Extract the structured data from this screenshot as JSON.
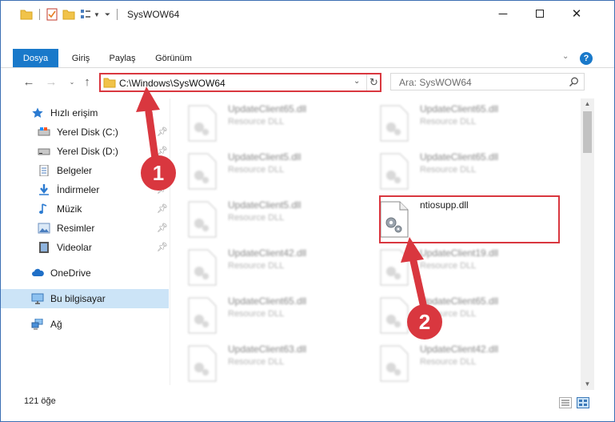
{
  "window": {
    "title": "SysWOW64",
    "minimize_icon": "minimize-icon",
    "maximize_icon": "maximize-icon",
    "close_icon": "close-icon"
  },
  "ribbon": {
    "tabs": [
      {
        "label": "Dosya"
      },
      {
        "label": "Giriş"
      },
      {
        "label": "Paylaş"
      },
      {
        "label": "Görünüm"
      }
    ],
    "help_glyph": "?"
  },
  "address": {
    "path": "C:\\Windows\\SysWOW64"
  },
  "search": {
    "placeholder": "Ara: SysWOW64"
  },
  "sidebar": {
    "items": [
      {
        "label": "Hızlı erişim",
        "icon": "star-icon",
        "pinned": false
      },
      {
        "label": "Yerel Disk (C:)",
        "icon": "drive-icon",
        "pinned": true
      },
      {
        "label": "Yerel Disk (D:)",
        "icon": "drive-icon",
        "pinned": true
      },
      {
        "label": "Belgeler",
        "icon": "documents-icon",
        "pinned": true
      },
      {
        "label": "İndirmeler",
        "icon": "download-icon",
        "pinned": true
      },
      {
        "label": "Müzik",
        "icon": "music-icon",
        "pinned": true
      },
      {
        "label": "Resimler",
        "icon": "pictures-icon",
        "pinned": true
      },
      {
        "label": "Videolar",
        "icon": "videos-icon",
        "pinned": true
      },
      {
        "label": "OneDrive",
        "icon": "cloud-icon",
        "pinned": false
      },
      {
        "label": "Bu bilgisayar",
        "icon": "computer-icon",
        "pinned": false,
        "selected": true
      },
      {
        "label": "Ağ",
        "icon": "network-icon",
        "pinned": false
      }
    ]
  },
  "files": {
    "left": [
      {
        "name": "UpdateClient65.dll",
        "type": "Resource DLL"
      },
      {
        "name": "UpdateClient5.dll",
        "type": "Resource DLL"
      },
      {
        "name": "UpdateClient5.dll",
        "type": "Resource DLL"
      },
      {
        "name": "UpdateClient42.dll",
        "type": "Resource DLL"
      },
      {
        "name": "UpdateClient65.dll",
        "type": "Resource DLL"
      },
      {
        "name": "UpdateClient63.dll",
        "type": "Resource DLL"
      }
    ],
    "right": [
      {
        "name": "UpdateClient65.dll",
        "type": "Resource DLL"
      },
      {
        "name": "UpdateClient65.dll",
        "type": "Resource DLL"
      },
      {
        "name": "ntiosupp.dll",
        "type": ""
      },
      {
        "name": "UpdateClient19.dll",
        "type": "Resource DLL"
      },
      {
        "name": "UpdateClient65.dll",
        "type": "Resource DLL"
      },
      {
        "name": "UpdateClient42.dll",
        "type": "Resource DLL"
      }
    ]
  },
  "status": {
    "item_count": "121 öğe"
  },
  "callouts": {
    "step1": "1",
    "step2": "2"
  },
  "colors": {
    "accent": "#1979ca",
    "highlight": "#d9373f",
    "selection": "#cce4f7"
  }
}
